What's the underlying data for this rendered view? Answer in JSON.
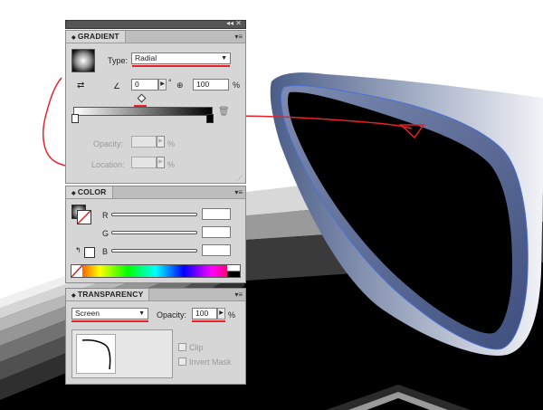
{
  "gradient_panel": {
    "title": "GRADIENT",
    "type_label": "Type:",
    "type_value": "Radial",
    "angle_value": "0",
    "degree_symbol": "°",
    "aspect_value": "100",
    "percent": "%",
    "opacity_label": "Opacity:",
    "location_label": "Location:"
  },
  "color_panel": {
    "title": "COLOR",
    "channels": [
      {
        "label": "R"
      },
      {
        "label": "G"
      },
      {
        "label": "B"
      }
    ]
  },
  "transparency_panel": {
    "title": "TRANSPARENCY",
    "blend_mode": "Screen",
    "opacity_label": "Opacity:",
    "opacity_value": "100",
    "percent": "%",
    "clip_label": "Clip",
    "invert_mask_label": "Invert Mask"
  },
  "colors": {
    "panel_bg": "#d6d6d6",
    "annotation_red": "#e8202a",
    "shape_blue": "#5b6f9a"
  },
  "icons": [
    "menu-icon",
    "gradient-swatch",
    "reverse-gradient-icon",
    "angle-icon",
    "aspect-ratio-icon",
    "trash-icon",
    "fill-swatch",
    "out-of-gamut-icon",
    "none-swatch",
    "spectrum-bar",
    "mask-thumbnail"
  ]
}
